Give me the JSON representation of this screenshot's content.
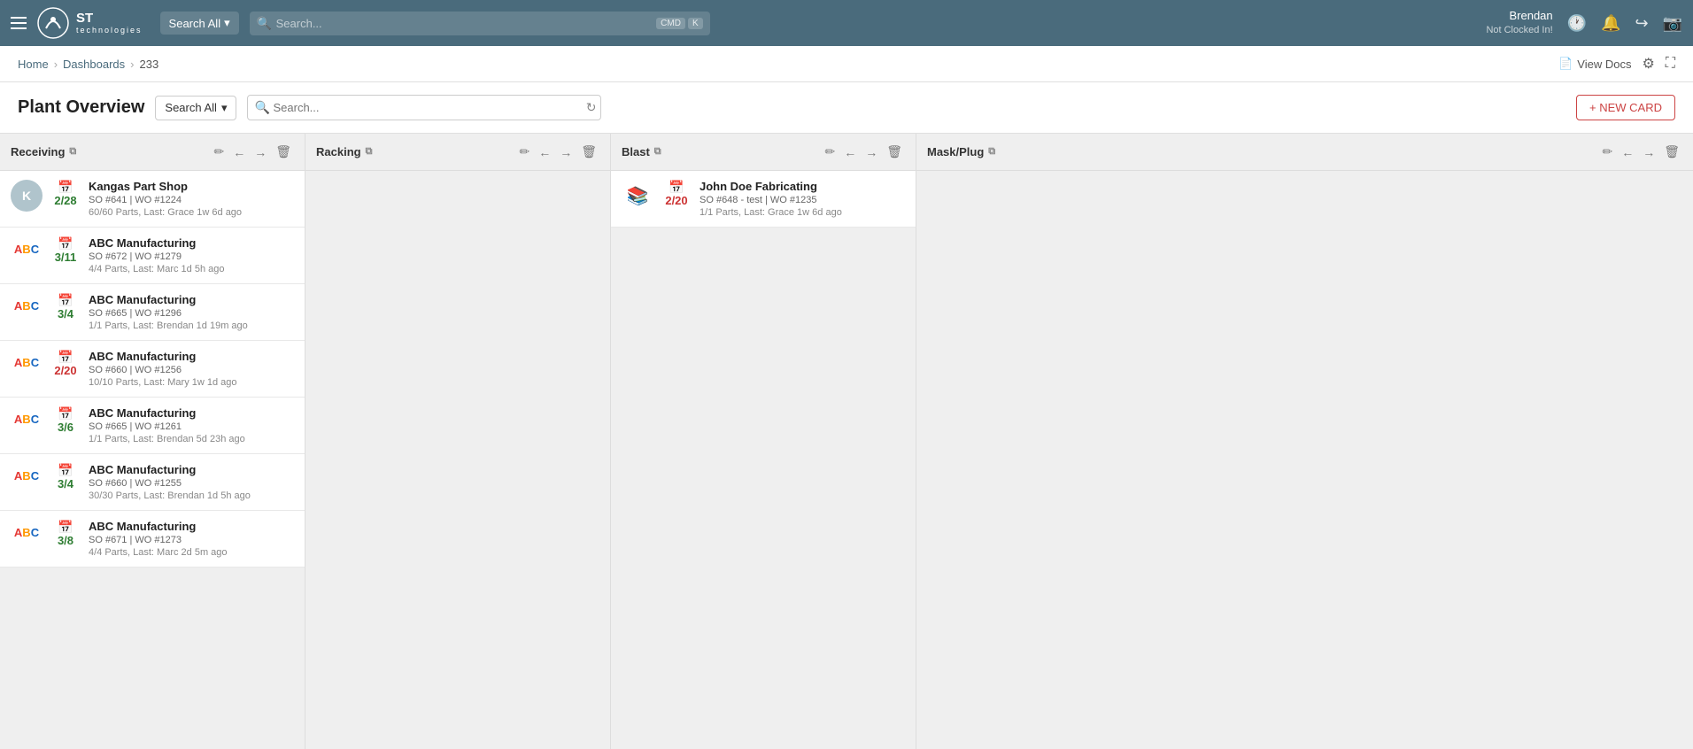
{
  "topNav": {
    "logo": "ST",
    "logoSub": "technologies",
    "searchAll": "Search All",
    "searchPlaceholder": "Search...",
    "kbdHint1": "CMD",
    "kbdHint2": "K",
    "user": {
      "name": "Brendan",
      "status": "Not Clocked In!"
    }
  },
  "breadcrumb": {
    "home": "Home",
    "dashboards": "Dashboards",
    "current": "233",
    "viewDocs": "View Docs"
  },
  "pageHeader": {
    "title": "Plant Overview",
    "searchScope": "Search All",
    "searchPlaceholder": "Search...",
    "newCard": "+ NEW CARD"
  },
  "columns": [
    {
      "id": "receiving",
      "title": "Receiving",
      "hasExternal": true,
      "cards": [
        {
          "company": "Kangas Part Shop",
          "avatarType": "initial",
          "avatarLetter": "K",
          "so": "SO #641",
          "wo": "WO #1224",
          "parts": "60/60 Parts, Last: Grace 1w 6d ago",
          "dateNum": "2/28",
          "dateColor": "green",
          "calColor": "green"
        },
        {
          "company": "ABC Manufacturing",
          "avatarType": "abc",
          "so": "SO #672",
          "wo": "WO #1279",
          "parts": "4/4 Parts, Last: Marc 1d 5h ago",
          "dateNum": "3/11",
          "dateColor": "green",
          "calColor": "green"
        },
        {
          "company": "ABC Manufacturing",
          "avatarType": "abc",
          "so": "SO #665",
          "wo": "WO #1296",
          "parts": "1/1 Parts, Last: Brendan 1d 19m ago",
          "dateNum": "3/4",
          "dateColor": "green",
          "calColor": "green"
        },
        {
          "company": "ABC Manufacturing",
          "avatarType": "abc",
          "so": "SO #660",
          "wo": "WO #1256",
          "parts": "10/10 Parts, Last: Mary 1w 1d ago",
          "dateNum": "2/20",
          "dateColor": "red",
          "calColor": "red"
        },
        {
          "company": "ABC Manufacturing",
          "avatarType": "abc",
          "so": "SO #665",
          "wo": "WO #1261",
          "parts": "1/1 Parts, Last: Brendan 5d 23h ago",
          "dateNum": "3/6",
          "dateColor": "green",
          "calColor": "green"
        },
        {
          "company": "ABC Manufacturing",
          "avatarType": "abc",
          "so": "SO #660",
          "wo": "WO #1255",
          "parts": "30/30 Parts, Last: Brendan 1d 5h ago",
          "dateNum": "3/4",
          "dateColor": "green",
          "calColor": "green"
        },
        {
          "company": "ABC Manufacturing",
          "avatarType": "abc",
          "so": "SO #671",
          "wo": "WO #1273",
          "parts": "4/4 Parts, Last: Marc 2d 5m ago",
          "dateNum": "3/8",
          "dateColor": "green",
          "calColor": "green"
        }
      ]
    },
    {
      "id": "racking",
      "title": "Racking",
      "hasExternal": true,
      "cards": []
    },
    {
      "id": "blast",
      "title": "Blast",
      "hasExternal": true,
      "cards": [
        {
          "company": "John Doe Fabricating",
          "avatarType": "books",
          "so": "SO #648 - test",
          "wo": "WO #1235",
          "parts": "1/1 Parts, Last: Grace 1w 6d ago",
          "dateNum": "2/20",
          "dateColor": "red",
          "calColor": "red"
        }
      ]
    },
    {
      "id": "maskplug",
      "title": "Mask/Plug",
      "hasExternal": true,
      "cards": []
    }
  ]
}
